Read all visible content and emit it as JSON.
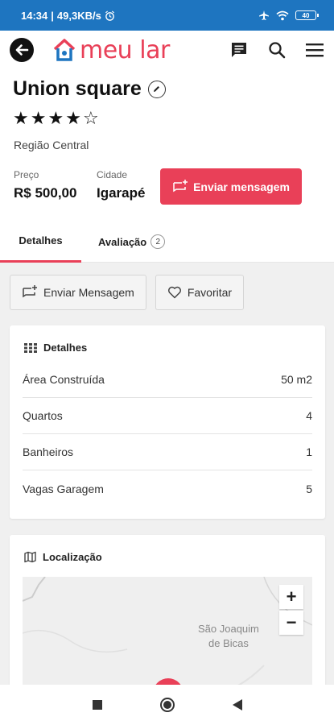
{
  "status_bar": {
    "time": "14:34",
    "speed": "49,3KB/s",
    "battery": "40"
  },
  "app_bar": {
    "logo_text": "meu lar",
    "icons": [
      "back-icon",
      "chat-icon",
      "search-icon",
      "menu-icon"
    ]
  },
  "property": {
    "title": "Union square",
    "rating": 4,
    "rating_max": 5,
    "region": "Região Central",
    "price_label": "Preço",
    "price": "R$ 500,00",
    "city_label": "Cidade",
    "city": "Igarapé",
    "message_button": "Enviar mensagem"
  },
  "tabs": [
    {
      "label": "Detalhes",
      "active": true
    },
    {
      "label": "Avaliação",
      "count": "2",
      "active": false
    }
  ],
  "actions": {
    "send_message": "Enviar Mensagem",
    "favorite": "Favoritar"
  },
  "details": {
    "title": "Detalhes",
    "rows": [
      {
        "label": "Área Construída",
        "value": "50 m2"
      },
      {
        "label": "Quartos",
        "value": "4"
      },
      {
        "label": "Banheiros",
        "value": "1"
      },
      {
        "label": "Vagas Garagem",
        "value": "5"
      }
    ]
  },
  "location": {
    "title": "Localização",
    "map_place_line1": "São Joaquim",
    "map_place_line2": "de Bicas",
    "zoom_in": "+",
    "zoom_out": "−"
  },
  "colors": {
    "accent": "#e94058",
    "status_bar": "#1e75c0"
  }
}
